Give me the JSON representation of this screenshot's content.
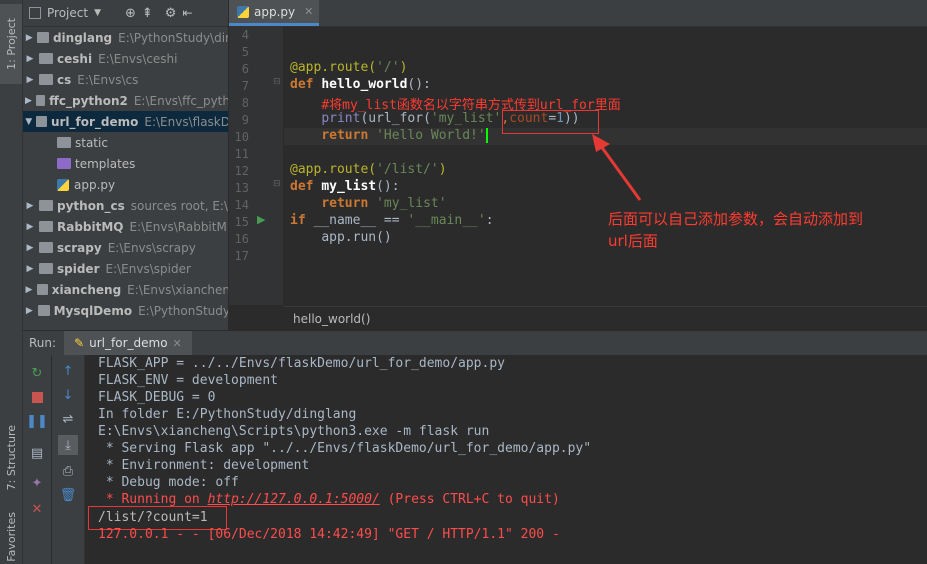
{
  "left_strip": {
    "project_label": "1: Project",
    "structure_label": "7: Structure",
    "favorites_label": "Favorites"
  },
  "project_pane": {
    "title": "Project",
    "tree": [
      {
        "name": "dinglang",
        "path": "E:\\PythonStudy\\dir",
        "expanded": false,
        "bold": true,
        "folder": "grey"
      },
      {
        "name": "ceshi",
        "path": "E:\\Envs\\ceshi",
        "expanded": false,
        "bold": true,
        "folder": "grey"
      },
      {
        "name": "cs",
        "path": "E:\\Envs\\cs",
        "expanded": false,
        "bold": true,
        "folder": "grey"
      },
      {
        "name": "ffc_python2",
        "path": "E:\\Envs\\ffc_pyth",
        "expanded": false,
        "bold": true,
        "folder": "grey"
      },
      {
        "name": "url_for_demo",
        "path": "E:\\Envs\\flaskD",
        "expanded": true,
        "bold": true,
        "folder": "grey",
        "selected": true
      },
      {
        "name": "static",
        "path": "",
        "expanded": null,
        "bold": false,
        "folder": "grey",
        "indent": 2
      },
      {
        "name": "templates",
        "path": "",
        "expanded": null,
        "bold": false,
        "folder": "purple",
        "indent": 2
      },
      {
        "name": "app.py",
        "path": "",
        "expanded": null,
        "bold": false,
        "folder": "python",
        "indent": 2
      },
      {
        "name": "python_cs",
        "path": "sources root, E:\\",
        "expanded": false,
        "bold": true,
        "folder": "grey"
      },
      {
        "name": "RabbitMQ",
        "path": "E:\\Envs\\RabbitM",
        "expanded": false,
        "bold": true,
        "folder": "grey"
      },
      {
        "name": "scrapy",
        "path": "E:\\Envs\\scrapy",
        "expanded": false,
        "bold": true,
        "folder": "grey"
      },
      {
        "name": "spider",
        "path": "E:\\Envs\\spider",
        "expanded": false,
        "bold": true,
        "folder": "grey"
      },
      {
        "name": "xiancheng",
        "path": "E:\\Envs\\xianchen",
        "expanded": false,
        "bold": true,
        "folder": "grey"
      },
      {
        "name": "MysqlDemo",
        "path": "E:\\PythonStudy",
        "expanded": false,
        "bold": true,
        "folder": "grey"
      }
    ]
  },
  "editor": {
    "tab_label": "app.py",
    "line_numbers": [
      "4",
      "5",
      "6",
      "7",
      "8",
      "9",
      "10",
      "11",
      "12",
      "13",
      "14",
      "15",
      "16",
      "17"
    ],
    "breadcrumb": "hello_world()"
  },
  "code": {
    "l6_dec": "@app.route(",
    "l6_str": "'/'",
    "l6_end": ")",
    "l7_kw": "def ",
    "l7_fn": "hello_world",
    "l7_end": "():",
    "l8_comment": "#将my_list函数名以字符串方式传到url_for里面",
    "l9_print": "print",
    "l9_a": "(url_for(",
    "l9_str": "'my_list'",
    "l9_b": ",",
    "l9_prm": "count",
    "l9_eq": "=",
    "l9_num": "1",
    "l9_end": "))",
    "l10_kw": "return ",
    "l10_str": "'Hello World!'",
    "l12_dec": "@app.route(",
    "l12_str": "'/list/'",
    "l12_end": ")",
    "l13_kw": "def ",
    "l13_fn": "my_list",
    "l13_end": "():",
    "l14_kw": "return ",
    "l14_str": "'my_list'",
    "l15_kw": "if ",
    "l15_a": "__name__ == ",
    "l15_str": "'__main__'",
    "l15_end": ":",
    "l16": "app.run()"
  },
  "annotation": {
    "line1": "后面可以自己添加参数，会自动添加到",
    "line2": "url后面"
  },
  "run_panel": {
    "run_label": "Run:",
    "config_tab": "url_for_demo",
    "console_lines": [
      {
        "text": "FLASK_APP = ../../Envs/flaskDemo/url_for_demo/app.py",
        "color": "normal"
      },
      {
        "text": "FLASK_ENV = development",
        "color": "normal"
      },
      {
        "text": "FLASK_DEBUG = 0",
        "color": "normal"
      },
      {
        "text": "In folder E:/PythonStudy/dinglang",
        "color": "normal"
      },
      {
        "text": "E:\\Envs\\xiancheng\\Scripts\\python3.exe -m flask run",
        "color": "normal"
      },
      {
        "text": " * Serving Flask app \"../../Envs/flaskDemo/url_for_demo/app.py\"",
        "color": "normal"
      },
      {
        "text": " * Environment: development",
        "color": "normal"
      },
      {
        "text": " * Debug mode: off",
        "color": "normal"
      }
    ],
    "running_prefix": " * Running on ",
    "running_url": "http://127.0.0.1:5000/",
    "running_suffix": " (Press CTRL+C to quit)",
    "request_path": "/list/?count=1",
    "log_line": "127.0.0.1 - - [06/Dec/2018 14:42:49] \"GET / HTTP/1.1\" 200 -"
  }
}
